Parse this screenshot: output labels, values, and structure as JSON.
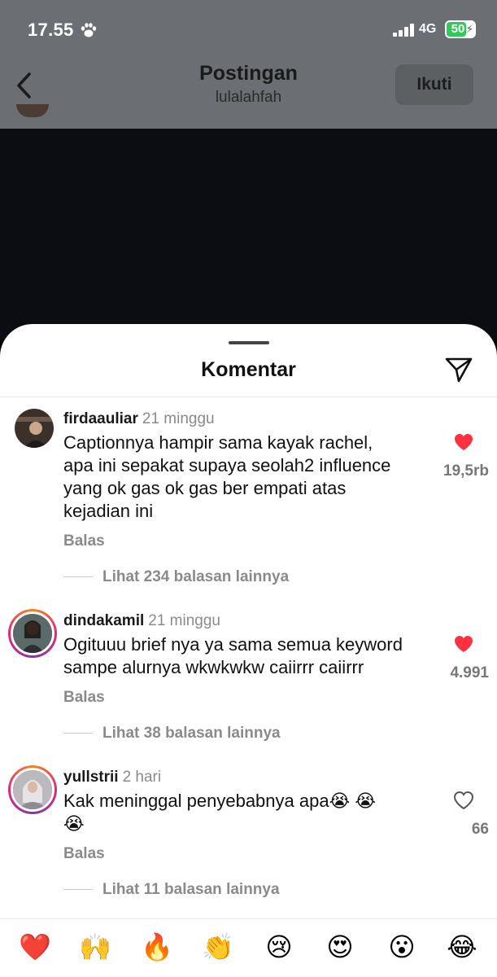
{
  "status_bar": {
    "time": "17.55",
    "network": "4G",
    "battery": "50"
  },
  "nav": {
    "title": "Postingan",
    "subtitle": "lulalahfah",
    "follow_label": "Ikuti"
  },
  "sheet": {
    "title": "Komentar"
  },
  "comments": [
    {
      "username": "firdaauliar",
      "time": "21 minggu",
      "text_lines": [
        "Captionnya hampir sama kayak rachel,",
        "apa ini sepakat supaya seolah2 influence",
        "yang ok gas ok gas ber empati atas",
        "kejadian ini"
      ],
      "reply_label": "Balas",
      "more_replies": "Lihat 234 balasan lainnya",
      "likes": "19,5rb",
      "liked": true
    },
    {
      "username": "dindakamil",
      "time": "21 minggu",
      "text_lines": [
        "Ogituuu brief nya ya sama semua keyword",
        "sampe alurnya wkwkwkw caiirrr caiirrr"
      ],
      "reply_label": "Balas",
      "more_replies": "Lihat 38 balasan lainnya",
      "likes": "4.991",
      "liked": true
    },
    {
      "username": "yullstrii",
      "time": "2 hari",
      "text_lines": [
        "Kak meninggal penyebabnya apa😭 😭",
        "😭"
      ],
      "reply_label": "Balas",
      "more_replies": "Lihat 11 balasan lainnya",
      "likes": "66",
      "liked": false
    }
  ],
  "emoji_bar": [
    "❤️",
    "🙌",
    "🔥",
    "👏",
    "😢",
    "😍",
    "😮",
    "😂"
  ],
  "colors": {
    "like_red": "#ff3040",
    "story_ring": "#dd2a7b",
    "battery_green": "#34c759"
  },
  "icons": {
    "back": "chevron-left-icon",
    "share": "paper-plane-icon",
    "paw": "paw-icon",
    "signal": "signal-bars-icon",
    "heart": "heart-icon"
  }
}
